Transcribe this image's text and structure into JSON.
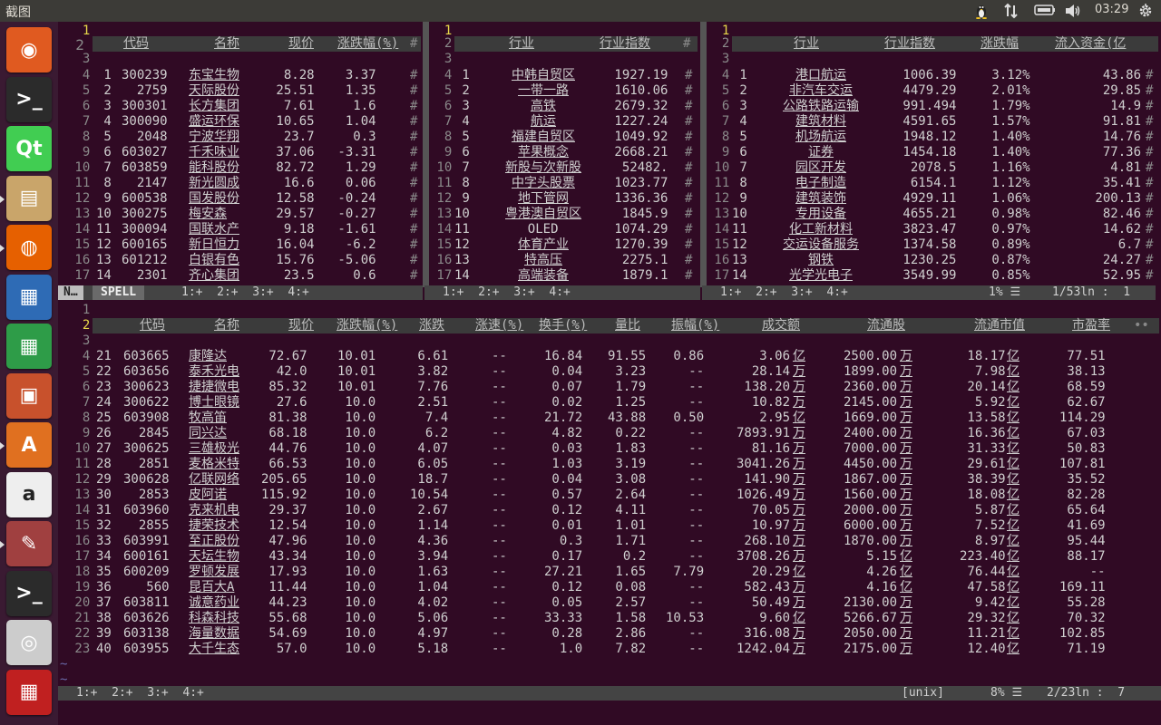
{
  "topbar": {
    "title": "截图",
    "time": "03:29",
    "icons": [
      "tux-icon",
      "network-arrows-icon",
      "battery-icon",
      "volume-icon",
      "gear-icon"
    ]
  },
  "launcher": [
    "ubuntu-dash-icon",
    "terminal-icon",
    "qt-creator-icon",
    "files-icon",
    "firefox-icon",
    "writer-icon",
    "calc-icon",
    "impress-icon",
    "software-center-icon",
    "amazon-icon",
    "system-settings-icon",
    "terminal-icon-2",
    "camera-icon",
    "rubbish-icon"
  ],
  "pane1": {
    "cols": [
      "代码",
      "名称",
      "现价",
      "涨跌幅(%)"
    ],
    "rows": [
      [
        "1",
        "300239",
        "东宝生物",
        "8.28",
        "3.37"
      ],
      [
        "2",
        "2759",
        "天际股份",
        "25.51",
        "1.35"
      ],
      [
        "3",
        "300301",
        "长方集团",
        "7.61",
        "1.6"
      ],
      [
        "4",
        "300090",
        "盛运环保",
        "10.65",
        "1.04"
      ],
      [
        "5",
        "2048",
        "宁波华翔",
        "23.7",
        "0.3"
      ],
      [
        "6",
        "603027",
        "千禾味业",
        "37.06",
        "-3.31"
      ],
      [
        "7",
        "603859",
        "能科股份",
        "82.72",
        "1.29"
      ],
      [
        "8",
        "2147",
        "新光圆成",
        "16.6",
        "0.06"
      ],
      [
        "9",
        "600538",
        "国发股份",
        "12.58",
        "-0.24"
      ],
      [
        "10",
        "300275",
        "梅安森",
        "29.57",
        "-0.27"
      ],
      [
        "11",
        "300094",
        "国联水产",
        "9.18",
        "-1.61"
      ],
      [
        "12",
        "600165",
        "新日恒力",
        "16.04",
        "-6.2"
      ],
      [
        "13",
        "601212",
        "白银有色",
        "15.76",
        "-5.06"
      ],
      [
        "14",
        "2301",
        "齐心集团",
        "23.5",
        "0.6"
      ]
    ],
    "status": {
      "mode": "N…",
      "spell": "SPELL",
      "tabs": "1:+  2:+  3:+  4:+"
    }
  },
  "pane2": {
    "cols": [
      "行业",
      "行业指数"
    ],
    "rows": [
      [
        "1",
        "中韩自贸区",
        "1927.19"
      ],
      [
        "2",
        "一带一路",
        "1610.06"
      ],
      [
        "3",
        "高铁",
        "2679.32"
      ],
      [
        "4",
        "航运",
        "1227.24"
      ],
      [
        "5",
        "福建自贸区",
        "1049.92"
      ],
      [
        "6",
        "苹果概念",
        "2668.21"
      ],
      [
        "7",
        "新股与次新股",
        "52482."
      ],
      [
        "8",
        "中字头股票",
        "1023.77"
      ],
      [
        "9",
        "地下管网",
        "1336.36"
      ],
      [
        "10",
        "粤港澳自贸区",
        "1845.9"
      ],
      [
        "11",
        "OLED",
        "1074.29"
      ],
      [
        "12",
        "体育产业",
        "1270.39"
      ],
      [
        "13",
        "特高压",
        "2275.1"
      ],
      [
        "14",
        "高端装备",
        "1879.1"
      ]
    ],
    "status": {
      "tabs": "1:+  2:+  3:+  4:+"
    }
  },
  "pane3": {
    "cols": [
      "行业",
      "行业指数",
      "涨跌幅",
      "流入资金(亿"
    ],
    "rows": [
      [
        "1",
        "港口航运",
        "1006.39",
        "3.12%",
        "43.86"
      ],
      [
        "2",
        "非汽车交运",
        "4479.29",
        "2.01%",
        "29.85"
      ],
      [
        "3",
        "公路铁路运输",
        "991.494",
        "1.79%",
        "14.9"
      ],
      [
        "4",
        "建筑材料",
        "4591.65",
        "1.57%",
        "91.81"
      ],
      [
        "5",
        "机场航运",
        "1948.12",
        "1.40%",
        "14.76"
      ],
      [
        "6",
        "证券",
        "1454.18",
        "1.40%",
        "77.36"
      ],
      [
        "7",
        "园区开发",
        "2078.5",
        "1.16%",
        "4.81"
      ],
      [
        "8",
        "电子制造",
        "6154.1",
        "1.12%",
        "35.41"
      ],
      [
        "9",
        "建筑装饰",
        "4929.11",
        "1.06%",
        "200.13"
      ],
      [
        "10",
        "专用设备",
        "4655.21",
        "0.98%",
        "82.46"
      ],
      [
        "11",
        "化工新材料",
        "3823.47",
        "0.97%",
        "14.62"
      ],
      [
        "12",
        "交运设备服务",
        "1374.58",
        "0.89%",
        "6.7"
      ],
      [
        "13",
        "钢铁",
        "1230.25",
        "0.87%",
        "24.27"
      ],
      [
        "14",
        "光学光电子",
        "3549.99",
        "0.85%",
        "52.95"
      ]
    ],
    "status": {
      "tabs": "1:+  2:+  3:+  4:+",
      "pct": "1%",
      "pos": "1/53ln :  1"
    }
  },
  "pane4": {
    "cols": [
      "代码",
      "名称",
      "现价",
      "涨跌幅(%)",
      "涨跌",
      "涨速(%)",
      "换手(%)",
      "量比",
      "振幅(%)",
      "成交额",
      "流通股",
      "流通市值",
      "市盈率"
    ],
    "rows": [
      [
        "21",
        "603665",
        "康隆达",
        "72.67",
        "10.01",
        "6.61",
        "--",
        "16.84",
        "91.55",
        "0.86",
        "3.06",
        "亿",
        "2500.00",
        "万",
        "18.17",
        "亿",
        "77.51"
      ],
      [
        "22",
        "603656",
        "泰禾光电",
        "42.0",
        "10.01",
        "3.82",
        "--",
        "0.04",
        "3.23",
        "--",
        "28.14",
        "万",
        "1899.00",
        "万",
        "7.98",
        "亿",
        "38.13"
      ],
      [
        "23",
        "300623",
        "捷捷微电",
        "85.32",
        "10.01",
        "7.76",
        "--",
        "0.07",
        "1.79",
        "--",
        "138.20",
        "万",
        "2360.00",
        "万",
        "20.14",
        "亿",
        "68.59"
      ],
      [
        "24",
        "300622",
        "博士眼镜",
        "27.6",
        "10.0",
        "2.51",
        "--",
        "0.02",
        "1.25",
        "--",
        "10.82",
        "万",
        "2145.00",
        "万",
        "5.92",
        "亿",
        "62.67"
      ],
      [
        "25",
        "603908",
        "牧高笛",
        "81.38",
        "10.0",
        "7.4",
        "--",
        "21.72",
        "43.88",
        "0.50",
        "2.95",
        "亿",
        "1669.00",
        "万",
        "13.58",
        "亿",
        "114.29"
      ],
      [
        "26",
        "2845",
        "同兴达",
        "68.18",
        "10.0",
        "6.2",
        "--",
        "4.82",
        "0.22",
        "--",
        "7893.91",
        "万",
        "2400.00",
        "万",
        "16.36",
        "亿",
        "67.03"
      ],
      [
        "27",
        "300625",
        "三雄极光",
        "44.76",
        "10.0",
        "4.07",
        "--",
        "0.03",
        "1.83",
        "--",
        "81.16",
        "万",
        "7000.00",
        "万",
        "31.33",
        "亿",
        "50.83"
      ],
      [
        "28",
        "2851",
        "麦格米特",
        "66.53",
        "10.0",
        "6.05",
        "--",
        "1.03",
        "3.19",
        "--",
        "3041.26",
        "万",
        "4450.00",
        "万",
        "29.61",
        "亿",
        "107.81"
      ],
      [
        "29",
        "300628",
        "亿联网络",
        "205.65",
        "10.0",
        "18.7",
        "--",
        "0.04",
        "3.08",
        "--",
        "141.90",
        "万",
        "1867.00",
        "万",
        "38.39",
        "亿",
        "35.52"
      ],
      [
        "30",
        "2853",
        "皮阿诺",
        "115.92",
        "10.0",
        "10.54",
        "--",
        "0.57",
        "2.64",
        "--",
        "1026.49",
        "万",
        "1560.00",
        "万",
        "18.08",
        "亿",
        "82.28"
      ],
      [
        "31",
        "603960",
        "克来机电",
        "29.37",
        "10.0",
        "2.67",
        "--",
        "0.12",
        "4.11",
        "--",
        "70.05",
        "万",
        "2000.00",
        "万",
        "5.87",
        "亿",
        "65.64"
      ],
      [
        "32",
        "2855",
        "捷荣技术",
        "12.54",
        "10.0",
        "1.14",
        "--",
        "0.01",
        "1.01",
        "--",
        "10.97",
        "万",
        "6000.00",
        "万",
        "7.52",
        "亿",
        "41.69"
      ],
      [
        "33",
        "603991",
        "至正股份",
        "47.96",
        "10.0",
        "4.36",
        "--",
        "0.3",
        "1.71",
        "--",
        "268.10",
        "万",
        "1870.00",
        "万",
        "8.97",
        "亿",
        "95.44"
      ],
      [
        "34",
        "600161",
        "天坛生物",
        "43.34",
        "10.0",
        "3.94",
        "--",
        "0.17",
        "0.2",
        "--",
        "3708.26",
        "万",
        "5.15",
        "亿",
        "223.40",
        "亿",
        "88.17"
      ],
      [
        "35",
        "600209",
        "罗顿发展",
        "17.93",
        "10.0",
        "1.63",
        "--",
        "27.21",
        "1.65",
        "7.79",
        "20.29",
        "亿",
        "4.26",
        "亿",
        "76.44",
        "亿",
        "--"
      ],
      [
        "36",
        "560",
        "昆百大A",
        "11.44",
        "10.0",
        "1.04",
        "--",
        "0.12",
        "0.08",
        "--",
        "582.43",
        "万",
        "4.16",
        "亿",
        "47.58",
        "亿",
        "169.11"
      ],
      [
        "37",
        "603811",
        "诚意药业",
        "44.23",
        "10.0",
        "4.02",
        "--",
        "0.05",
        "2.57",
        "--",
        "50.49",
        "万",
        "2130.00",
        "万",
        "9.42",
        "亿",
        "55.28"
      ],
      [
        "38",
        "603626",
        "科森科技",
        "55.68",
        "10.0",
        "5.06",
        "--",
        "33.33",
        "1.58",
        "10.53",
        "9.60",
        "亿",
        "5266.67",
        "万",
        "29.32",
        "亿",
        "70.32"
      ],
      [
        "39",
        "603138",
        "海量数据",
        "54.69",
        "10.0",
        "4.97",
        "--",
        "0.28",
        "2.86",
        "--",
        "316.08",
        "万",
        "2050.00",
        "万",
        "11.21",
        "亿",
        "102.85"
      ],
      [
        "40",
        "603955",
        "大千生态",
        "57.0",
        "10.0",
        "5.18",
        "--",
        "1.0",
        "7.82",
        "--",
        "1242.04",
        "万",
        "2175.00",
        "万",
        "12.40",
        "亿",
        "71.19"
      ]
    ],
    "status": {
      "tabs": "1:+  2:+  3:+  4:+",
      "ff": "[unix]",
      "pct": "8%",
      "pos": "2/23ln :  7"
    }
  }
}
